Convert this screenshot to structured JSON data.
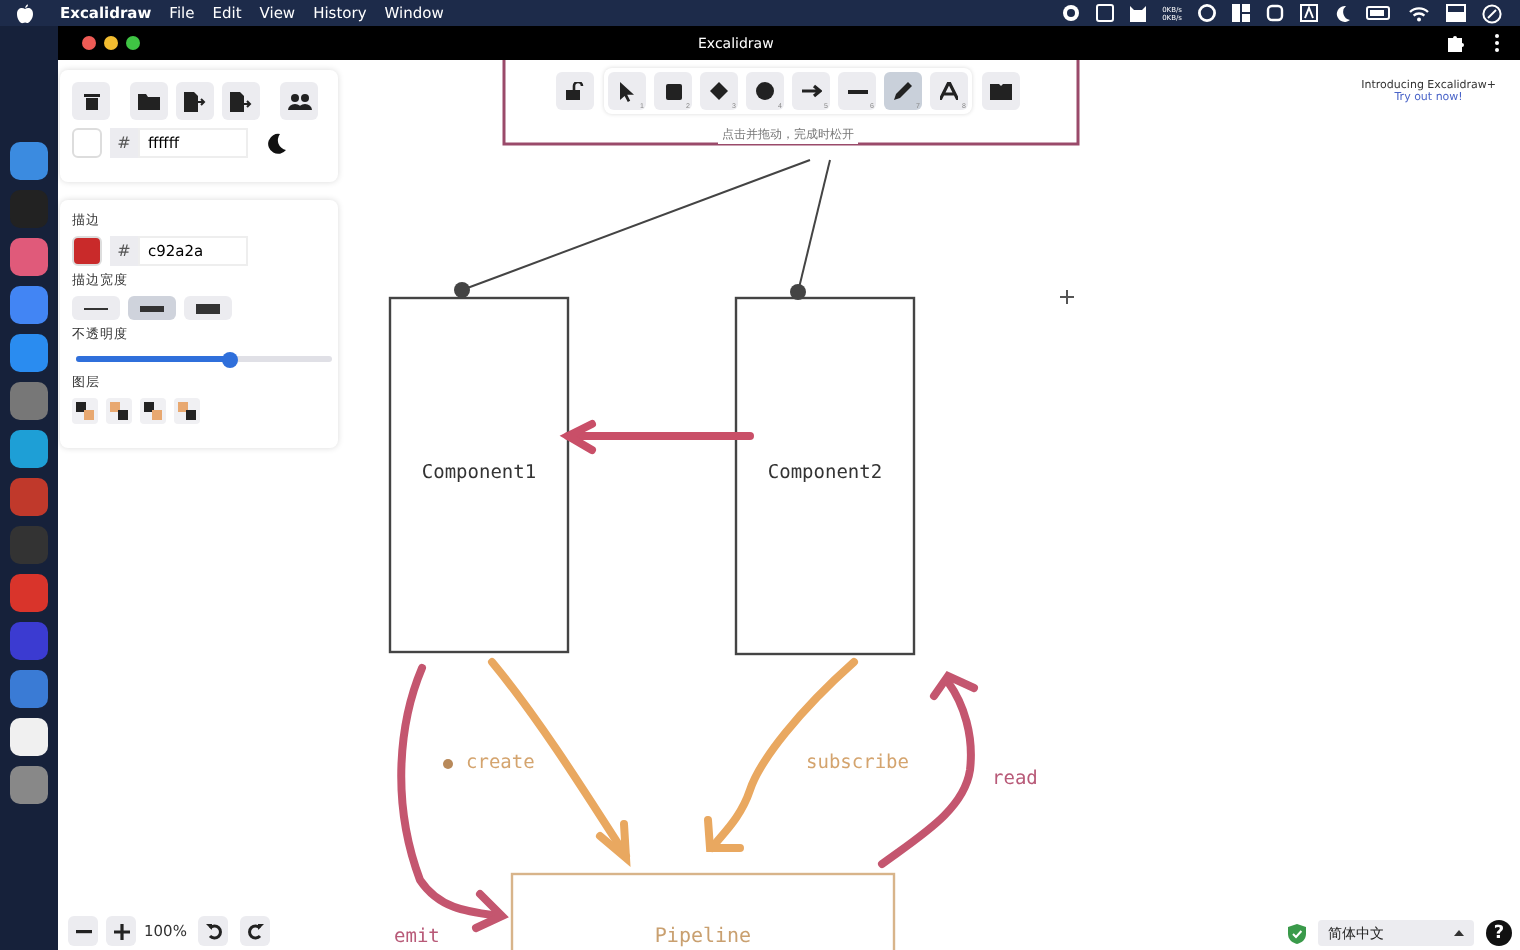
{
  "menu_bar": {
    "app_name": "Excalidraw",
    "menus": [
      "File",
      "Edit",
      "View",
      "History",
      "Window"
    ],
    "network_speed": [
      "0KB/s",
      "0KB/s"
    ]
  },
  "window": {
    "title": "Excalidraw"
  },
  "left_panel": {
    "background": {
      "hash": "#",
      "value": "ffffff"
    },
    "stroke": {
      "label": "描边",
      "color": "#c92a2a",
      "hash": "#",
      "value": "c92a2a"
    },
    "stroke_width": {
      "label": "描边宽度",
      "options": [
        {
          "kind": "thin",
          "selected": false
        },
        {
          "kind": "bold",
          "selected": true
        },
        {
          "kind": "extra",
          "selected": false
        }
      ]
    },
    "opacity": {
      "label": "不透明度",
      "level": 0.6
    },
    "layers": {
      "label": "图层"
    }
  },
  "toolbar": {
    "tools": [
      {
        "kind": "select",
        "key": "1",
        "selected": false
      },
      {
        "kind": "rectangle",
        "key": "2",
        "selected": false
      },
      {
        "kind": "diamond",
        "key": "3",
        "selected": false
      },
      {
        "kind": "ellipse",
        "key": "4",
        "selected": false
      },
      {
        "kind": "arrow",
        "key": "5",
        "selected": false
      },
      {
        "kind": "line",
        "key": "6",
        "selected": false
      },
      {
        "kind": "pencil",
        "key": "7",
        "selected": true
      },
      {
        "kind": "text",
        "key": "8",
        "selected": false
      }
    ],
    "hint": "点击并拖动，完成时松开"
  },
  "promo": {
    "title": "Introducing Excalidraw+",
    "link": "Try out now!"
  },
  "canvas": {
    "nodes": [
      {
        "label": "Component1"
      },
      {
        "label": "Component2"
      },
      {
        "label": "Pipeline"
      }
    ],
    "edge_labels": [
      {
        "kind": "create",
        "text": "create"
      },
      {
        "kind": "subscribe",
        "text": "subscribe"
      },
      {
        "kind": "read",
        "text": "read"
      },
      {
        "kind": "emit",
        "text": "emit"
      }
    ]
  },
  "footer": {
    "zoom": "100%",
    "language": "简体中文",
    "help": "?"
  }
}
